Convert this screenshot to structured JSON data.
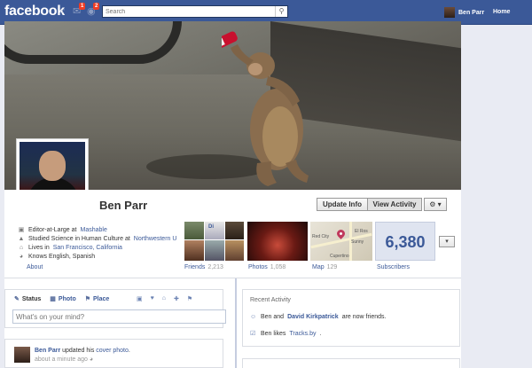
{
  "topbar": {
    "logo": "facebook",
    "search_placeholder": "Search",
    "notifications": [
      {
        "icon": "friend-requests-icon",
        "badge": ""
      },
      {
        "icon": "messages-icon",
        "badge": "1"
      },
      {
        "icon": "notifications-icon",
        "badge": "2"
      }
    ],
    "user_name": "Ben Parr",
    "home_label": "Home"
  },
  "profile": {
    "name": "Ben Parr",
    "update_info_label": "Update Info",
    "view_activity_label": "View Activity",
    "gear_label": "⚙ ▾"
  },
  "about": {
    "rows": [
      {
        "icon": "briefcase-icon",
        "prefix": "Editor-at-Large at ",
        "link": "Mashable"
      },
      {
        "icon": "graduation-icon",
        "prefix": "Studied Science in Human Culture at ",
        "link": "Northwestern U"
      },
      {
        "icon": "home-icon",
        "prefix": "Lives in ",
        "link": "San Francisco, California"
      },
      {
        "icon": "globe-icon",
        "prefix": "Knows English, Spanish",
        "link": ""
      }
    ],
    "label": "About"
  },
  "tiles": {
    "friends": {
      "label": "Friends",
      "count": "2,213"
    },
    "photos": {
      "label": "Photos",
      "count": "1,058"
    },
    "map": {
      "label": "Map",
      "count": "129",
      "places": [
        "Red City",
        "Sunny",
        "Cupertino",
        "El Ros"
      ]
    },
    "subscribers": {
      "label": "Subscribers",
      "value": "6,380"
    },
    "friend_tile_text": "Di"
  },
  "composer": {
    "tabs": [
      {
        "icon": "status-icon",
        "label": "Status"
      },
      {
        "icon": "photo-icon",
        "label": "Photo"
      },
      {
        "icon": "place-icon",
        "label": "Place"
      }
    ],
    "placeholder": "What's on your mind?"
  },
  "story": {
    "author": "Ben Parr",
    "action": " updated his ",
    "object": "cover photo",
    "suffix": ".",
    "time": "about a minute ago"
  },
  "recent_activity": {
    "title": "Recent Activity",
    "items": [
      {
        "icon": "friends-icon",
        "pre": "Ben and ",
        "link": "David Kirkpatrick",
        "post": " are now friends."
      },
      {
        "icon": "like-icon",
        "pre": "Ben likes ",
        "link": "Tracks.by",
        "post": "."
      }
    ]
  },
  "colors": {
    "brand": "#3b5998",
    "badge": "#f03d25"
  }
}
